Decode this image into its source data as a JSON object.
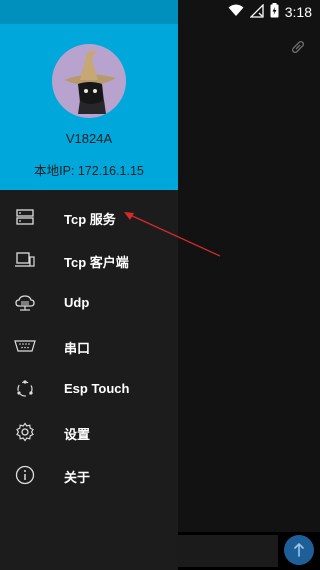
{
  "status_bar": {
    "time": "3:18"
  },
  "drawer": {
    "device_name": "V1824A",
    "local_ip": "本地IP: 172.16.1.15",
    "menu": [
      {
        "label": "Tcp 服务",
        "icon": "server-icon"
      },
      {
        "label": "Tcp 客户端",
        "icon": "client-device-icon"
      },
      {
        "label": "Udp",
        "icon": "cloud-network-icon"
      },
      {
        "label": "串口",
        "icon": "serial-port-icon"
      },
      {
        "label": "Esp Touch",
        "icon": "esp-touch-icon"
      },
      {
        "label": "设置",
        "icon": "settings-gear-icon"
      },
      {
        "label": "关于",
        "icon": "info-icon"
      }
    ]
  },
  "colors": {
    "header": "#00a7db",
    "drawer_background": "#1c1c1c",
    "annotation_arrow": "#d42a2a",
    "fab": "#1e5f9a"
  }
}
